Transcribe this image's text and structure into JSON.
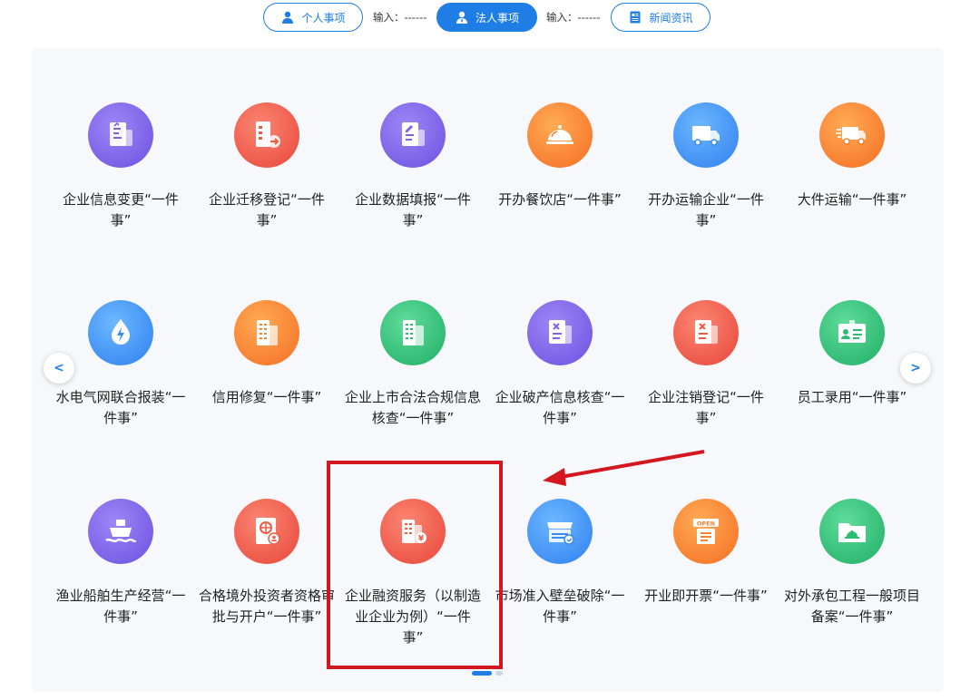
{
  "tabs": {
    "personal": "个人事项",
    "legal": "法人事项",
    "news": "新闻资讯",
    "input_label_1": "输入：------",
    "input_label_2": "输入：------"
  },
  "nav": {
    "prev": "<",
    "next": ">"
  },
  "tiles": [
    {
      "label": "企业信息变更“一件事”",
      "icon": "document-edit-icon"
    },
    {
      "label": "企业迁移登记“一件事”",
      "icon": "building-move-icon"
    },
    {
      "label": "企业数据填报“一件事”",
      "icon": "form-fill-icon"
    },
    {
      "label": "开办餐饮店“一件事”",
      "icon": "food-cloche-icon"
    },
    {
      "label": "开办运输企业“一件事”",
      "icon": "truck-icon"
    },
    {
      "label": "大件运输“一件事”",
      "icon": "heavy-truck-icon"
    },
    {
      "label": "水电气网联合报装“一件事”",
      "icon": "utility-drop-icon"
    },
    {
      "label": "信用修复“一件事”",
      "icon": "building-icon"
    },
    {
      "label": "企业上市合法合规信息核查“一件事”",
      "icon": "buildings-icon"
    },
    {
      "label": "企业破产信息核查“一件事”",
      "icon": "bankruptcy-doc-icon"
    },
    {
      "label": "企业注销登记“一件事”",
      "icon": "cancel-doc-icon"
    },
    {
      "label": "员工录用“一件事”",
      "icon": "id-card-icon"
    },
    {
      "label": "渔业船舶生产经营“一件事”",
      "icon": "ship-icon"
    },
    {
      "label": "合格境外投资者资格审批与开户“一件事”",
      "icon": "passport-icon"
    },
    {
      "label": "企业融资服务（以制造业企业为例）“一件事”",
      "icon": "finance-building-icon"
    },
    {
      "label": "市场准入壁垒破除“一件事”",
      "icon": "market-store-icon"
    },
    {
      "label": "开业即开票“一件事”",
      "icon": "open-sign-icon"
    },
    {
      "label": "对外承包工程一般项目备案“一件事”",
      "icon": "folder-project-icon"
    }
  ],
  "colors": {
    "accent": "#1f7de6",
    "highlight": "#d4161e"
  }
}
